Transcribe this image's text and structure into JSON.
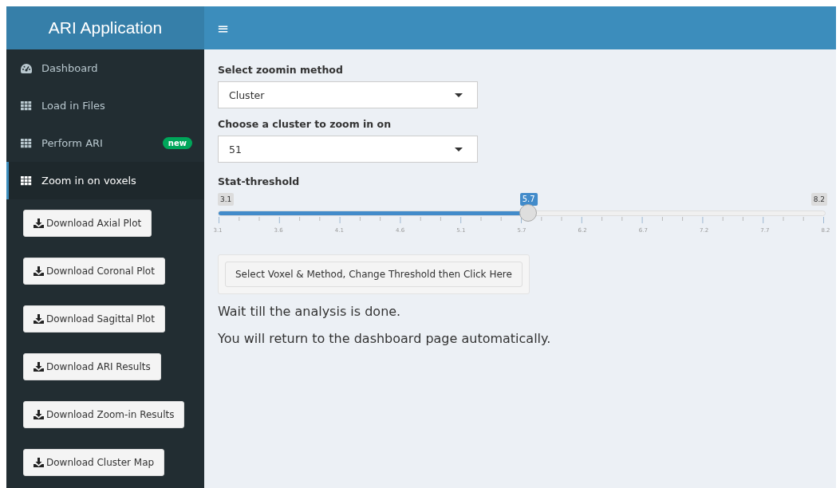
{
  "header": {
    "logo": "ARI Application",
    "menu_toggle": "≡"
  },
  "sidebar": {
    "items": [
      {
        "label": "Dashboard",
        "kind": "dashboard",
        "selected": false
      },
      {
        "label": "Load in Files",
        "kind": "grid",
        "selected": false
      },
      {
        "label": "Perform ARI",
        "kind": "grid",
        "selected": false,
        "badge": "new"
      },
      {
        "label": "Zoom in on voxels",
        "kind": "grid",
        "selected": true
      }
    ],
    "buttons": [
      "Download Axial Plot",
      "Download Coronal Plot",
      "Download Sagittal Plot",
      "Download ARI Results",
      "Download Zoom-in Results",
      "Download Cluster Map"
    ]
  },
  "form": {
    "method_select": {
      "label": "Select zoomin method",
      "value": "Cluster"
    },
    "cluster_select": {
      "label": "Choose a cluster to zoom in on",
      "value": "51"
    },
    "slider": {
      "label": "Stat-threshold",
      "min": "3.1",
      "max": "8.2",
      "value": "5.7",
      "level": 0.51,
      "ticks": [
        "3.1",
        "3.6",
        "4.1",
        "4.6",
        "5.1",
        "5.7",
        "6.2",
        "6.7",
        "7.2",
        "7.7",
        "8.2"
      ]
    },
    "run_button": "Select Voxel & Method, Change Threshold then Click Here",
    "messages": [
      "Wait till the analysis is done.",
      "You will return to the dashboard page automatically."
    ]
  }
}
